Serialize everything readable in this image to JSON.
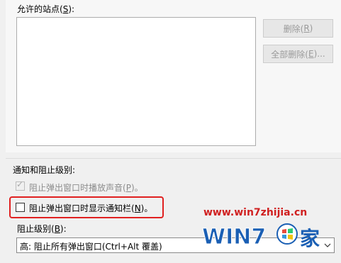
{
  "popup_settings": {
    "allowed_sites_label": "允许的站点(",
    "allowed_sites_key": "S",
    "allowed_sites_label_end": "):",
    "allowed_sites": [],
    "remove_label": "删除(",
    "remove_key": "R",
    "remove_label_end": ")",
    "remove_all_label": "全部删除(",
    "remove_all_key": "E",
    "remove_all_label_end": ")...",
    "notify_heading": "通知和阻止级别:",
    "play_sound_label": "阻止弹出窗口时播放声音(",
    "play_sound_key": "P",
    "play_sound_label_end": ")。",
    "play_sound_checked": true,
    "show_bar_label": "阻止弹出窗口时显示通知栏(",
    "show_bar_key": "N",
    "show_bar_label_end": ")。",
    "show_bar_checked": false,
    "block_level_label": "阻止级别(",
    "block_level_key": "B",
    "block_level_label_end": "):",
    "block_level_value": "高: 阻止所有弹出窗口(Ctrl+Alt 覆盖)"
  },
  "watermark": {
    "url": "www.win7zhijia.cn",
    "brand_text": "WIN7",
    "brand_suffix": "家"
  },
  "colors": {
    "highlight": "#e02020",
    "watermark_red": "#d02020",
    "watermark_blue": "#1a5fb4"
  },
  "icons": {
    "checkbox_checked": "checkmark-icon",
    "select_arrow": "chevron-down-icon",
    "logo": "windows-logo-icon"
  }
}
